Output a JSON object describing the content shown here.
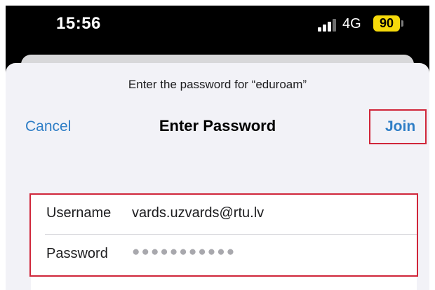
{
  "status_bar": {
    "time": "15:56",
    "network": "4G",
    "battery": "90",
    "signal_icon": "cellular-signal-icon",
    "battery_color": "#f5d90a"
  },
  "dialog": {
    "prompt": "Enter the password for “eduroam”",
    "title": "Enter Password",
    "cancel_label": "Cancel",
    "join_label": "Join"
  },
  "form": {
    "username_label": "Username",
    "username_value": "vards.uzvards@rtu.lv",
    "password_label": "Password",
    "password_masked": "●●●●●●●●●●●"
  },
  "colors": {
    "accent": "#2f7ec6",
    "highlight": "#d0263a"
  }
}
